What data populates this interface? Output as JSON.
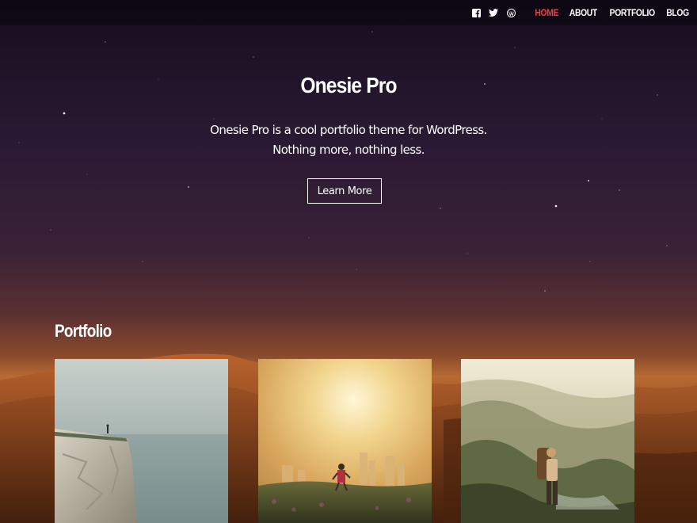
{
  "header": {
    "social_icons": [
      "facebook-icon",
      "twitter-icon",
      "wordpress-icon"
    ],
    "nav": [
      {
        "label": "HOME",
        "active": true
      },
      {
        "label": "ABOUT",
        "active": false
      },
      {
        "label": "PORTFOLIO",
        "active": false
      },
      {
        "label": "BLOG",
        "active": false
      }
    ]
  },
  "hero": {
    "title": "Onesie Pro",
    "tagline_line1": "Onesie Pro is a cool portfolio theme for WordPress.",
    "tagline_line2": "Nothing more, nothing less.",
    "button_label": "Learn More"
  },
  "portfolio": {
    "heading": "Portfolio",
    "items": [
      {
        "image": "person standing on seaside cliff in mist"
      },
      {
        "image": "runner in sunlit field with city skyline"
      },
      {
        "image": "hiker with backpack on mountain ridge"
      }
    ]
  },
  "colors": {
    "active_nav": "#ff3b3b",
    "text": "#ffffff"
  }
}
